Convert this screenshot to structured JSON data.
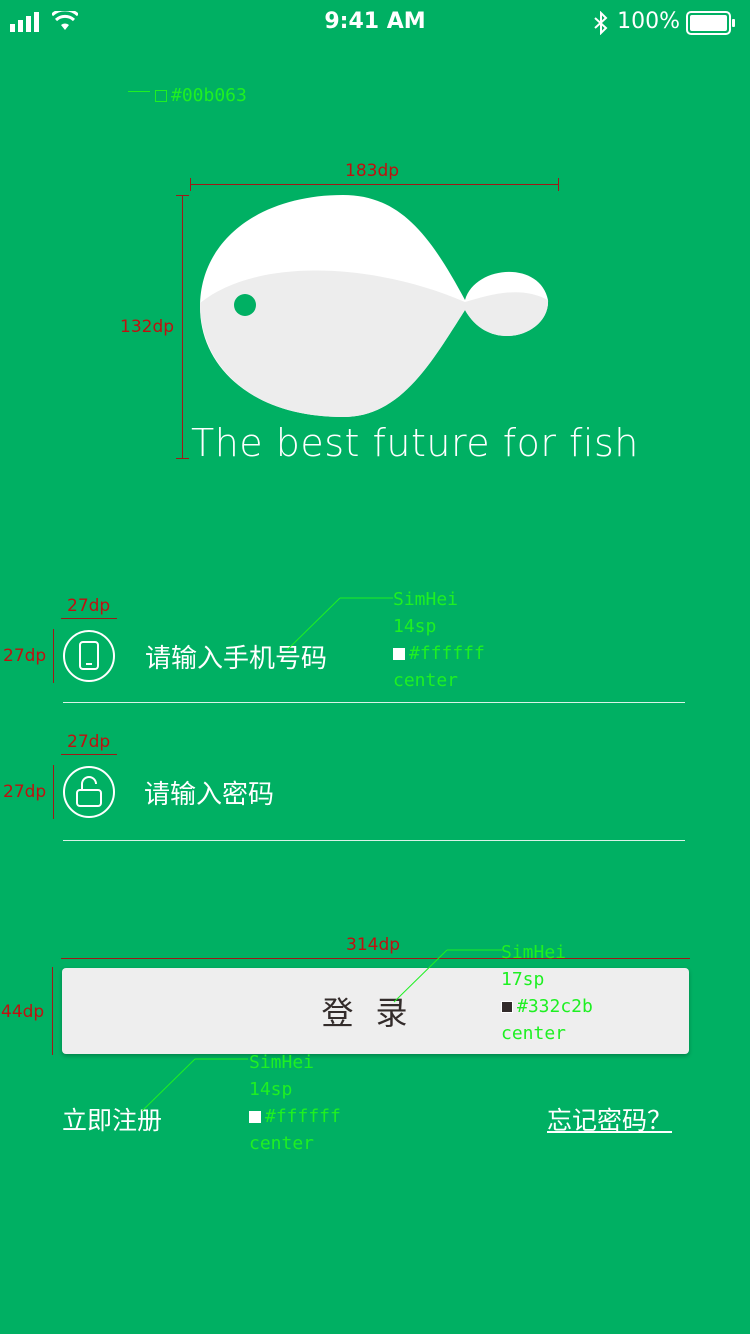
{
  "status_bar": {
    "time": "9:41 AM",
    "battery": "100%",
    "icons": [
      "signal-icon",
      "wifi-icon",
      "bluetooth-icon",
      "battery-icon"
    ]
  },
  "annotations": {
    "bg_color": "#00b063",
    "logo_width": "183dp",
    "logo_height": "132dp",
    "icon_size_w": "27dp",
    "icon_size_h": "27dp",
    "icon2_size_w": "27dp",
    "icon2_size_h": "27dp",
    "input_font": "SimHei",
    "input_size": "14sp",
    "input_color": "#ffffff",
    "input_align": "center",
    "button_width": "314dp",
    "button_height": "44dp",
    "button_font": "SimHei",
    "button_size": "17sp",
    "button_color": "#332c2b",
    "button_align": "center",
    "link_font": "SimHei",
    "link_size": "14sp",
    "link_color": "#ffffff",
    "link_align": "center"
  },
  "logo": {
    "slogan": "The best future for fish"
  },
  "form": {
    "phone_placeholder": "请输入手机号码",
    "password_placeholder": "请输入密码",
    "login_label": "登录",
    "register_label": "立即注册",
    "forgot_label": "忘记密码？"
  },
  "colors": {
    "background": "#00b063",
    "button_bg": "#eeeeee",
    "button_text": "#332c2b"
  }
}
